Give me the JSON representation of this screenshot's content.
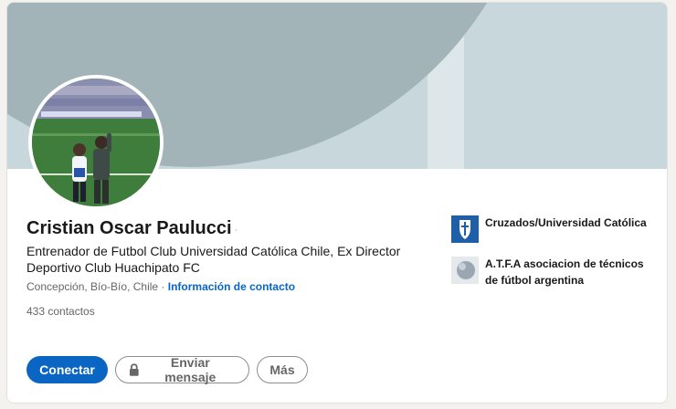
{
  "profile": {
    "name": "Cristian Oscar Paulucci",
    "name_suffix": "·",
    "headline": "Entrenador de Futbol Club Universidad Católica Chile, Ex Director Deportivo Club Huachipato FC",
    "location": "Concepción, Bío-Bío, Chile",
    "separator": " · ",
    "contact_info_label": "Información de contacto",
    "connections": "433 contactos"
  },
  "organizations": [
    {
      "name": "Cruzados/Universidad Católica",
      "icon": "cruzados-logo-icon"
    },
    {
      "name": "A.T.F.A asociacion de técnicos de fútbol argentina",
      "icon": "atfa-logo-icon"
    }
  ],
  "actions": {
    "connect_label": "Conectar",
    "message_label": "Enviar mensaje",
    "more_label": "Más"
  },
  "colors": {
    "primary": "#0a66c2",
    "cover_base": "#c8d7dc",
    "cover_circle": "#a3b4b9",
    "cover_band": "#dde7ea"
  }
}
